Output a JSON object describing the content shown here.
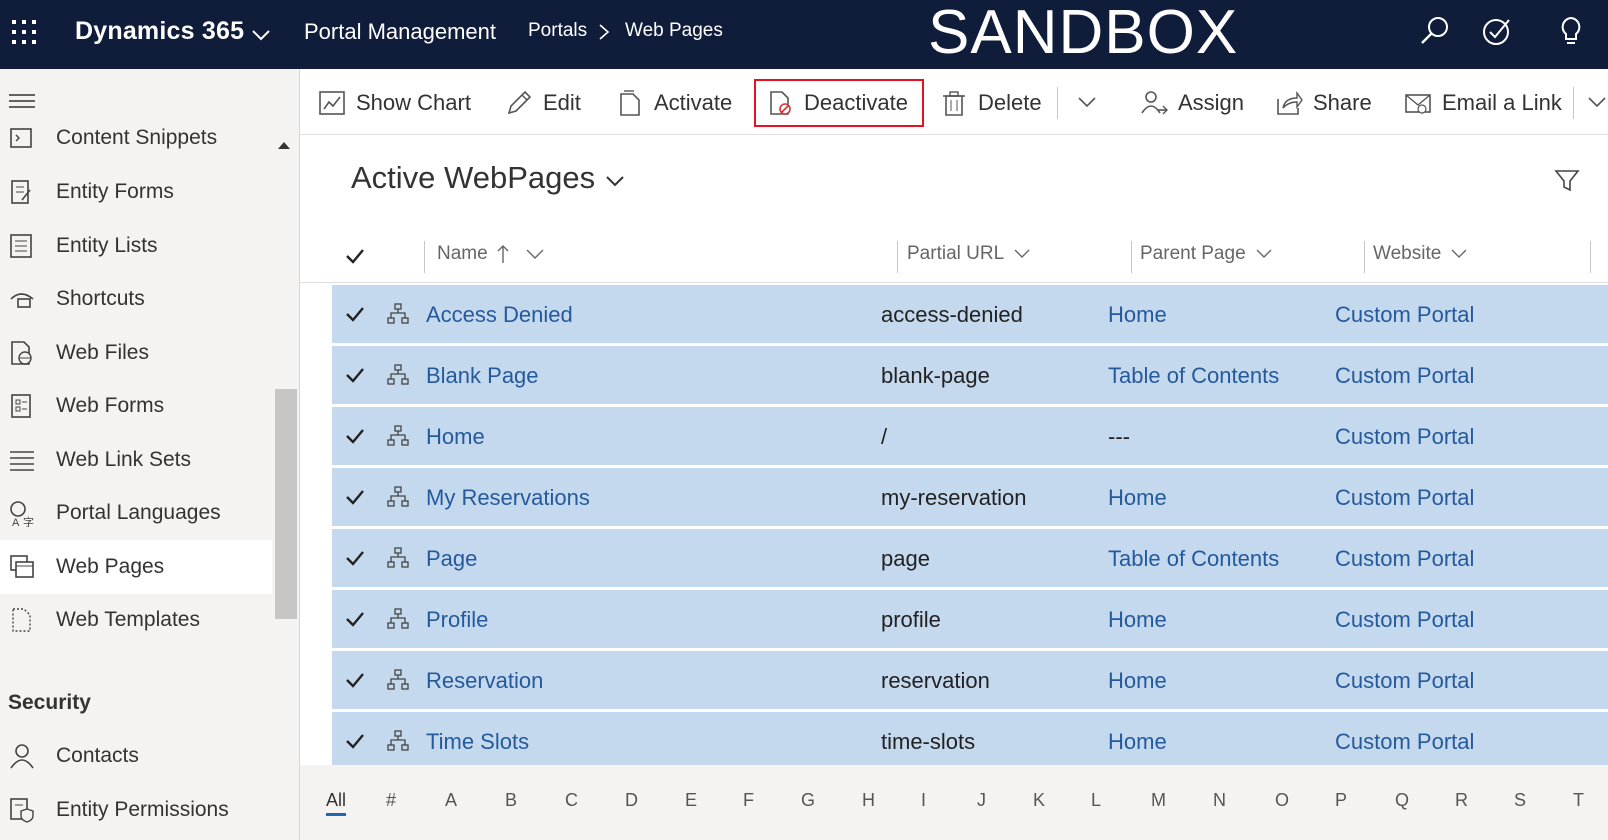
{
  "topbar": {
    "app_title": "Dynamics 365",
    "app_name": "Portal Management",
    "breadcrumb": [
      "Portals",
      "Web Pages"
    ],
    "environment": "SANDBOX",
    "icons": [
      "search-icon",
      "task-icon",
      "lightbulb-icon"
    ]
  },
  "sidebar": {
    "items": [
      {
        "label": "Content Snippets",
        "icon": "snippet-icon"
      },
      {
        "label": "Entity Forms",
        "icon": "form-icon"
      },
      {
        "label": "Entity Lists",
        "icon": "list-icon"
      },
      {
        "label": "Shortcuts",
        "icon": "shortcut-icon"
      },
      {
        "label": "Web Files",
        "icon": "web-file-icon"
      },
      {
        "label": "Web Forms",
        "icon": "web-form-icon"
      },
      {
        "label": "Web Link Sets",
        "icon": "link-set-icon"
      },
      {
        "label": "Portal Languages",
        "icon": "language-icon"
      },
      {
        "label": "Web Pages",
        "icon": "web-pages-icon",
        "active": true
      },
      {
        "label": "Web Templates",
        "icon": "template-icon"
      }
    ],
    "group_title": "Security",
    "security_items": [
      {
        "label": "Contacts",
        "icon": "contact-icon"
      },
      {
        "label": "Entity Permissions",
        "icon": "permission-icon"
      }
    ]
  },
  "commands": {
    "show_chart": "Show Chart",
    "edit": "Edit",
    "activate": "Activate",
    "deactivate": "Deactivate",
    "delete": "Delete",
    "assign": "Assign",
    "share": "Share",
    "email_link": "Email a Link"
  },
  "view": {
    "title": "Active WebPages"
  },
  "grid": {
    "columns": [
      "Name",
      "Partial URL",
      "Parent Page",
      "Website"
    ],
    "rows": [
      {
        "name": "Access Denied",
        "partial_url": "access-denied",
        "parent": "Home",
        "website": "Custom Portal"
      },
      {
        "name": "Blank Page",
        "partial_url": "blank-page",
        "parent": "Table of Contents",
        "website": "Custom Portal"
      },
      {
        "name": "Home",
        "partial_url": "/",
        "parent": "---",
        "website": "Custom Portal"
      },
      {
        "name": "My Reservations",
        "partial_url": "my-reservation",
        "parent": "Home",
        "website": "Custom Portal"
      },
      {
        "name": "Page",
        "partial_url": "page",
        "parent": "Table of Contents",
        "website": "Custom Portal"
      },
      {
        "name": "Profile",
        "partial_url": "profile",
        "parent": "Home",
        "website": "Custom Portal"
      },
      {
        "name": "Reservation",
        "partial_url": "reservation",
        "parent": "Home",
        "website": "Custom Portal"
      },
      {
        "name": "Time Slots",
        "partial_url": "time-slots",
        "parent": "Home",
        "website": "Custom Portal"
      }
    ]
  },
  "alphabet": [
    "All",
    "#",
    "A",
    "B",
    "C",
    "D",
    "E",
    "F",
    "G",
    "H",
    "I",
    "J",
    "K",
    "L",
    "M",
    "N",
    "O",
    "P",
    "Q",
    "R",
    "S",
    "T"
  ],
  "colors": {
    "topbar_bg": "#0f1c3a",
    "row_selected_bg": "#c5d9ee",
    "link": "#245a9c",
    "highlight_border": "#e81123"
  }
}
